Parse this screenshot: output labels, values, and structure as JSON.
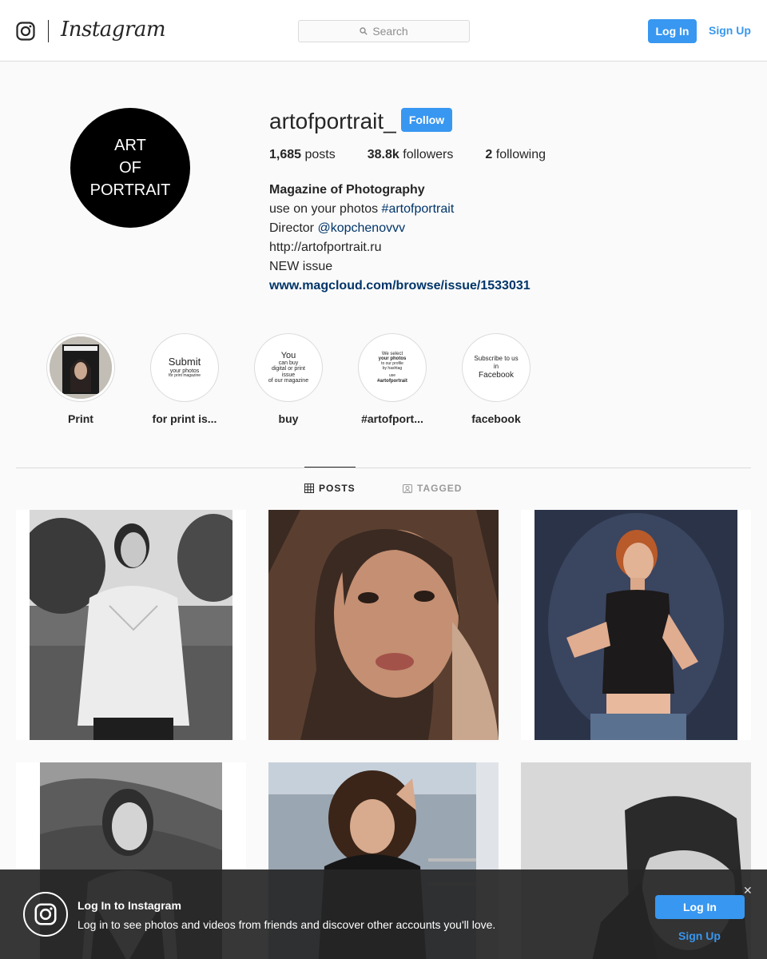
{
  "nav": {
    "logo_icon": "instagram-glyph-icon",
    "wordmark": "Instagram",
    "search_placeholder": "Search",
    "login_label": "Log In",
    "signup_label": "Sign Up",
    "accent_color": "#3897f0"
  },
  "profile": {
    "avatar_lines": [
      "ART",
      "OF",
      "PORTRAIT"
    ],
    "username": "artofportrait_",
    "follow_label": "Follow",
    "posts_count": "1,685",
    "posts_label": "posts",
    "followers_count": "38.8k",
    "followers_label": "followers",
    "following_count": "2",
    "following_label": "following",
    "full_name": "Magazine of Photography",
    "bio_line1_prefix": "use on your photos ",
    "bio_line1_tag": "#artofportrait",
    "bio_line2_prefix": "Director ",
    "bio_line2_mention": "@kopchenovvv",
    "bio_line3": "http://artofportrait.ru",
    "bio_line4": "NEW issue",
    "website": "www.magcloud.com/browse/issue/1533031"
  },
  "highlights": [
    {
      "label": "Print",
      "cover": "magazine cover thumbnail"
    },
    {
      "label": "for print is...",
      "cover_title": "Submit",
      "cover_sub1": "your photos",
      "cover_sub2": "for print magazine"
    },
    {
      "label": "buy",
      "cover_lines": [
        "You",
        "can buy",
        "digital or print",
        "issue",
        "of our magazine"
      ]
    },
    {
      "label": "#artofport...",
      "cover_lines": [
        "We select",
        "your photos",
        "to our profile",
        "by hashtag",
        "use",
        "#artofportrait"
      ]
    },
    {
      "label": "facebook",
      "cover_lines": [
        "Subscribe to us",
        "in",
        "Facebook"
      ]
    }
  ],
  "tabs": {
    "posts_label": "POSTS",
    "posts_icon": "grid-icon",
    "tagged_label": "TAGGED",
    "tagged_icon": "tag-icon"
  },
  "banner": {
    "title": "Log In to Instagram",
    "subtitle": "Log in to see photos and videos from friends and discover other accounts you'll love.",
    "login_label": "Log In",
    "signup_label": "Sign Up",
    "close_icon": "close-icon"
  }
}
